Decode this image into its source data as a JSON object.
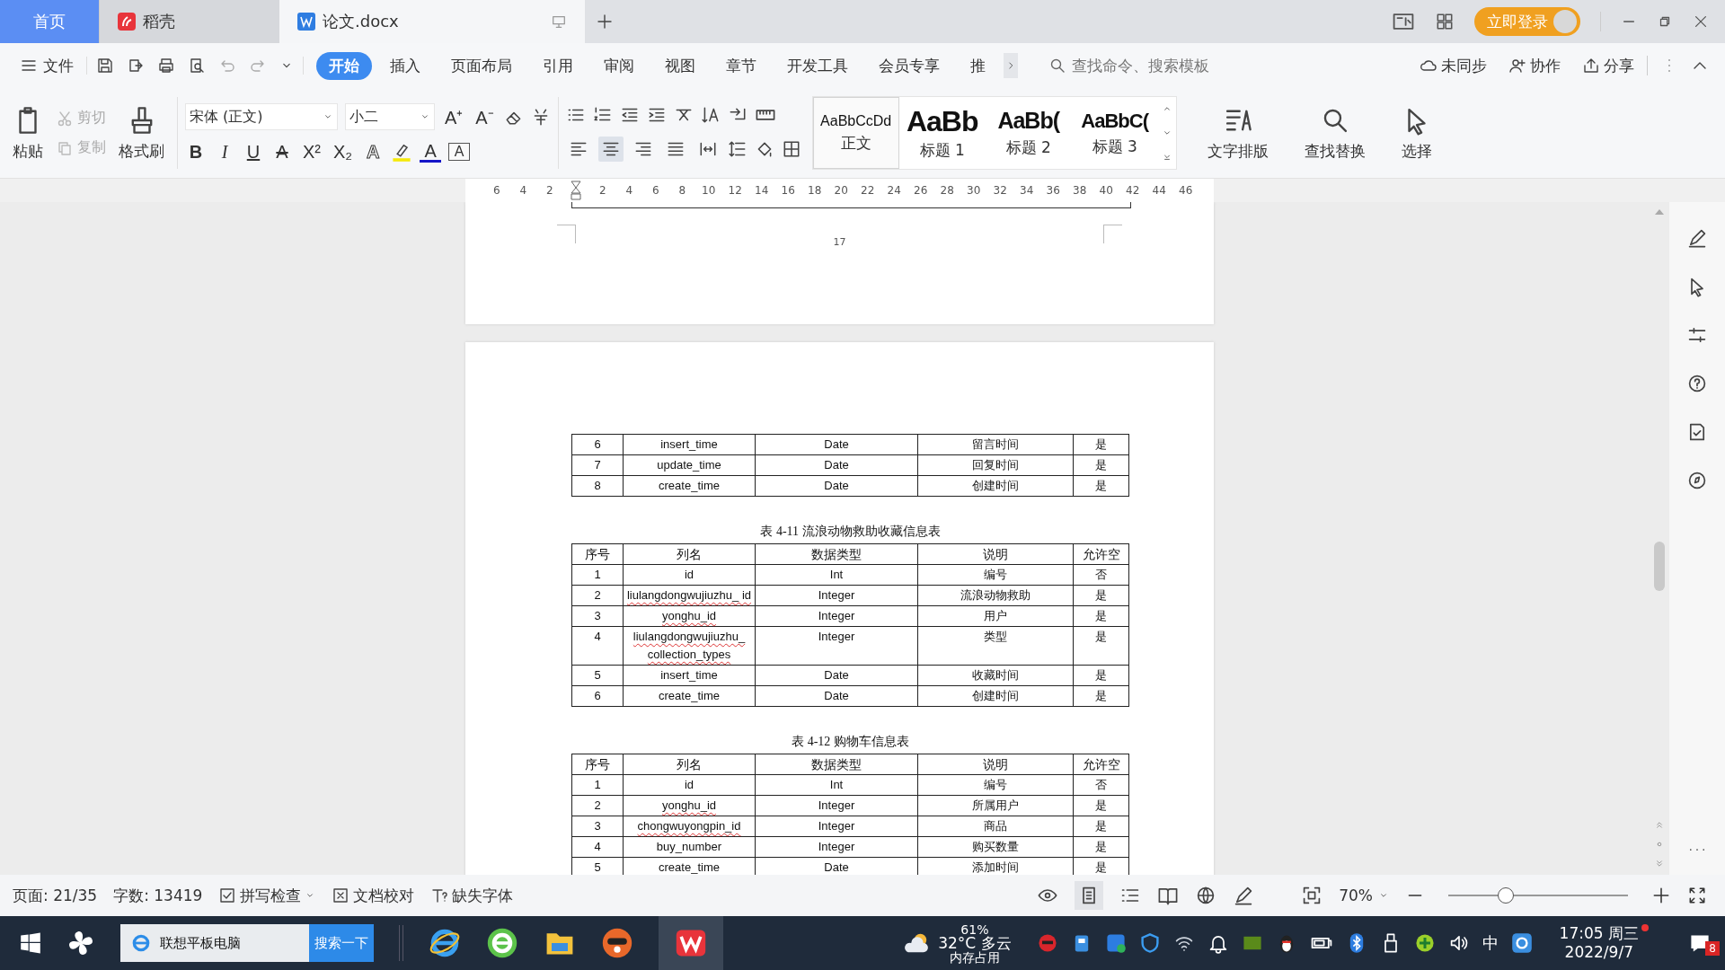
{
  "tabs": [
    {
      "kind": "home",
      "label": "首页",
      "selected": false
    },
    {
      "kind": "app",
      "label": "稻壳",
      "selected": false
    },
    {
      "kind": "doc",
      "label": "论文.docx",
      "selected": true
    }
  ],
  "login_button": "立即登录",
  "file_menu": "文件",
  "ribbon_tabs": [
    {
      "label": "开始",
      "selected": true
    },
    {
      "label": "插入",
      "selected": false
    },
    {
      "label": "页面布局",
      "selected": false
    },
    {
      "label": "引用",
      "selected": false
    },
    {
      "label": "审阅",
      "selected": false
    },
    {
      "label": "视图",
      "selected": false
    },
    {
      "label": "章节",
      "selected": false
    },
    {
      "label": "开发工具",
      "selected": false
    },
    {
      "label": "会员专享",
      "selected": false
    },
    {
      "label": "推",
      "selected": false
    }
  ],
  "command_search": {
    "placeholder": "查找命令、搜索模板"
  },
  "ribbon_actions": [
    "未同步",
    "协作",
    "分享"
  ],
  "clipboard": {
    "paste": "粘贴",
    "cut": {
      "label": "剪切",
      "disabled": true
    },
    "copy": {
      "label": "复制",
      "disabled": true
    },
    "format_painter": "格式刷"
  },
  "font": {
    "family": "宋体 (正文)",
    "size": "小二"
  },
  "size_buttons": [
    "A⁺",
    "A⁻"
  ],
  "format_buttons": [
    {
      "kind": "bold",
      "glyph": "B"
    },
    {
      "kind": "italic",
      "glyph": "I"
    },
    {
      "kind": "underline",
      "glyph": "U"
    },
    {
      "kind": "strike",
      "glyph": "A"
    },
    {
      "kind": "sup",
      "glyph": "X²"
    },
    {
      "kind": "sub",
      "glyph": "X₂"
    },
    {
      "kind": "outline",
      "glyph": "A"
    },
    {
      "kind": "highlight"
    },
    {
      "kind": "color",
      "glyph": "A"
    },
    {
      "kind": "boxed",
      "glyph": "A"
    }
  ],
  "align_buttons": [
    {
      "kind": "left",
      "selected": false
    },
    {
      "kind": "center",
      "selected": true
    },
    {
      "kind": "right",
      "selected": false
    },
    {
      "kind": "justify",
      "selected": false
    },
    {
      "kind": "distribute",
      "selected": false
    }
  ],
  "styles": [
    {
      "preview": "AaBbCcDd",
      "label": "正文",
      "selected": true,
      "kind": "body"
    },
    {
      "preview": "AaBb",
      "label": "标题 1",
      "selected": false,
      "kind": "h1"
    },
    {
      "preview": "AaBb(",
      "label": "标题 2",
      "selected": false,
      "kind": "h2"
    },
    {
      "preview": "AaBbC(",
      "label": "标题 3",
      "selected": false,
      "kind": "h3"
    }
  ],
  "tools": [
    "文字排版",
    "查找替换",
    "选择"
  ],
  "ruler_ticks": [
    "6",
    "4",
    "2",
    "2",
    "4",
    "6",
    "8",
    "10",
    "12",
    "14",
    "16",
    "18",
    "20",
    "22",
    "24",
    "26",
    "28",
    "30",
    "32",
    "34",
    "36",
    "38",
    "40",
    "42",
    "44",
    "46"
  ],
  "page_number": "17",
  "tables": [
    {
      "rows": [
        {
          "cells": [
            "6",
            "insert_time",
            "Date",
            "留言时间",
            "是"
          ],
          "misspelled": false
        },
        {
          "cells": [
            "7",
            "update_time",
            "Date",
            "回复时间",
            "是"
          ],
          "misspelled": false
        },
        {
          "cells": [
            "8",
            "create_time",
            "Date",
            "创建时间",
            "是"
          ],
          "misspelled": false
        }
      ]
    },
    {
      "caption": "表 4-11 流浪动物救助收藏信息表",
      "header": [
        "序号",
        "列名",
        "数据类型",
        "说明",
        "允许空"
      ],
      "rows": [
        {
          "cells": [
            "1",
            "id",
            "Int",
            "编号",
            "否"
          ],
          "misspelled": false
        },
        {
          "cells": [
            "2",
            "liulangdongwujiuzhu_ id",
            "Integer",
            "流浪动物救助",
            "是"
          ],
          "misspelled": true
        },
        {
          "cells": [
            "3",
            "yonghu_id",
            "Integer",
            "用户",
            "是"
          ],
          "misspelled": true
        },
        {
          "cells": [
            "4",
            "liulangdongwujiuzhu_ collection_types",
            "Integer",
            "类型",
            "是"
          ],
          "misspelled": true
        },
        {
          "cells": [
            "5",
            "insert_time",
            "Date",
            "收藏时间",
            "是"
          ],
          "misspelled": false
        },
        {
          "cells": [
            "6",
            "create_time",
            "Date",
            "创建时间",
            "是"
          ],
          "misspelled": false
        }
      ]
    },
    {
      "caption": "表 4-12 购物车信息表",
      "header": [
        "序号",
        "列名",
        "数据类型",
        "说明",
        "允许空"
      ],
      "rows": [
        {
          "cells": [
            "1",
            "id",
            "Int",
            "编号",
            "否"
          ],
          "misspelled": false
        },
        {
          "cells": [
            "2",
            "yonghu_id",
            "Integer",
            "所属用户",
            "是"
          ],
          "misspelled": true
        },
        {
          "cells": [
            "3",
            "chongwuyongpin_id",
            "Integer",
            "商品",
            "是"
          ],
          "misspelled": true
        },
        {
          "cells": [
            "4",
            "buy_number",
            "Integer",
            "购买数量",
            "是"
          ],
          "misspelled": false
        },
        {
          "cells": [
            "5",
            "create_time",
            "Date",
            "添加时间",
            "是"
          ],
          "misspelled": false
        }
      ]
    }
  ],
  "status_bar": {
    "page": "页面: 21/35",
    "words": "字数: 13419",
    "spell_check": "拼写检查",
    "proofread": "文档校对",
    "missing_fonts": "缺失字体",
    "zoom": "70%",
    "zoom_slider": {
      "level": 0.32
    }
  },
  "taskbar": {
    "search": {
      "value": "联想平板电脑"
    },
    "search_button": "搜索一下",
    "weather": "32°C 多云",
    "memory_percent": "61%",
    "memory_label": "内存占用",
    "ime": "中",
    "time": "17:05 周三",
    "date": "2022/9/7",
    "notification_count": "8"
  }
}
